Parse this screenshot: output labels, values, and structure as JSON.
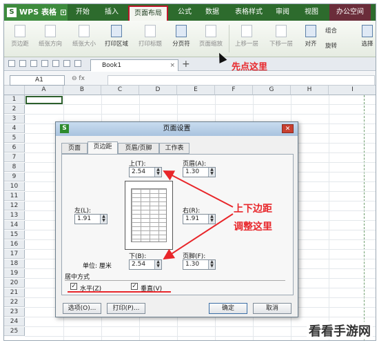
{
  "app": {
    "logo": "WPS 表格",
    "menu_tabs": [
      "开始",
      "插入",
      "页面布局",
      "公式",
      "数据",
      "表格样式",
      "审阅",
      "视图",
      "办公空间"
    ],
    "active_tab": "页面布局"
  },
  "ribbon": {
    "buttons": [
      "页边距",
      "纸张方向",
      "纸张大小",
      "打印区域",
      "打印标题",
      "分页符",
      "页面缩放",
      "上移一层",
      "下移一层",
      "对齐",
      "组合",
      "旋转",
      "选择"
    ]
  },
  "workbook": {
    "tab": "Book1",
    "new_tab": "+"
  },
  "annotation_top": "先点这里",
  "formula_bar": {
    "cell_ref": "A1",
    "fx": "fx"
  },
  "sheet": {
    "columns": [
      "A",
      "B",
      "C",
      "D",
      "E",
      "F",
      "G",
      "H",
      "I"
    ],
    "rows": [
      "1",
      "2",
      "3",
      "4",
      "5",
      "6",
      "7",
      "8",
      "9",
      "10",
      "11",
      "12",
      "13",
      "14",
      "15",
      "16",
      "17",
      "18",
      "19",
      "20",
      "21",
      "22",
      "23",
      "24",
      "25"
    ]
  },
  "dialog": {
    "title": "页面设置",
    "tabs": [
      "页面",
      "页边距",
      "页眉/页脚",
      "工作表"
    ],
    "selected_tab": "页边距",
    "top_label": "上(T):",
    "top_value": "2.54",
    "header_label": "页眉(A):",
    "header_value": "1.30",
    "left_label": "左(L):",
    "left_value": "1.91",
    "right_label": "右(R):",
    "right_value": "1.91",
    "bottom_label": "下(B):",
    "bottom_value": "2.54",
    "footer_label": "页脚(F):",
    "footer_value": "1.30",
    "unit_label": "单位: 厘米",
    "center_label": "居中方式",
    "horizontal_label": "水平(Z)",
    "vertical_label": "垂直(V)",
    "options_button": "选项(O)...",
    "print_button": "打印(P)...",
    "ok_button": "确定",
    "cancel_button": "取消"
  },
  "annotation_right": {
    "line1": "上下边距",
    "line2": "调整这里"
  },
  "watermark": "看看手游网"
}
